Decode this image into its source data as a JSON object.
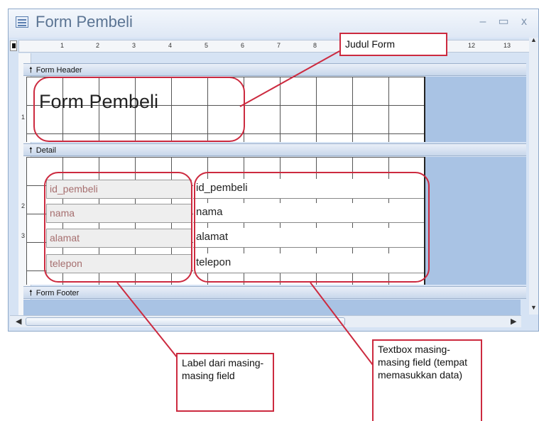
{
  "window": {
    "title": "Form Pembeli",
    "minimize_glyph": "–",
    "maximize_glyph": "▭",
    "close_glyph": "x"
  },
  "ruler": {
    "top_ticks": [
      "1",
      "2",
      "3",
      "4",
      "5",
      "6",
      "7",
      "8"
    ],
    "top_ticks_right": [
      "12",
      "13"
    ],
    "left_ticks": [
      "1",
      "2",
      "3"
    ]
  },
  "sections": {
    "header": "Form Header",
    "detail": "Detail",
    "footer": "Form Footer"
  },
  "form_header": {
    "title": "Form Pembeli"
  },
  "fields": [
    {
      "label": "id_pembeli",
      "textbox": "id_pembeli"
    },
    {
      "label": "nama",
      "textbox": "nama"
    },
    {
      "label": "alamat",
      "textbox": "alamat"
    },
    {
      "label": "telepon",
      "textbox": "telepon"
    }
  ],
  "annotations": {
    "judul": "Judul Form",
    "label": "Label dari masing-masing field",
    "textbox": "Textbox masing-masing field (tempat memasukkan data)"
  },
  "colors": {
    "highlight": "#cc2a3f",
    "section_blue": "#a9c3e4",
    "label_text": "#a66f6f"
  }
}
